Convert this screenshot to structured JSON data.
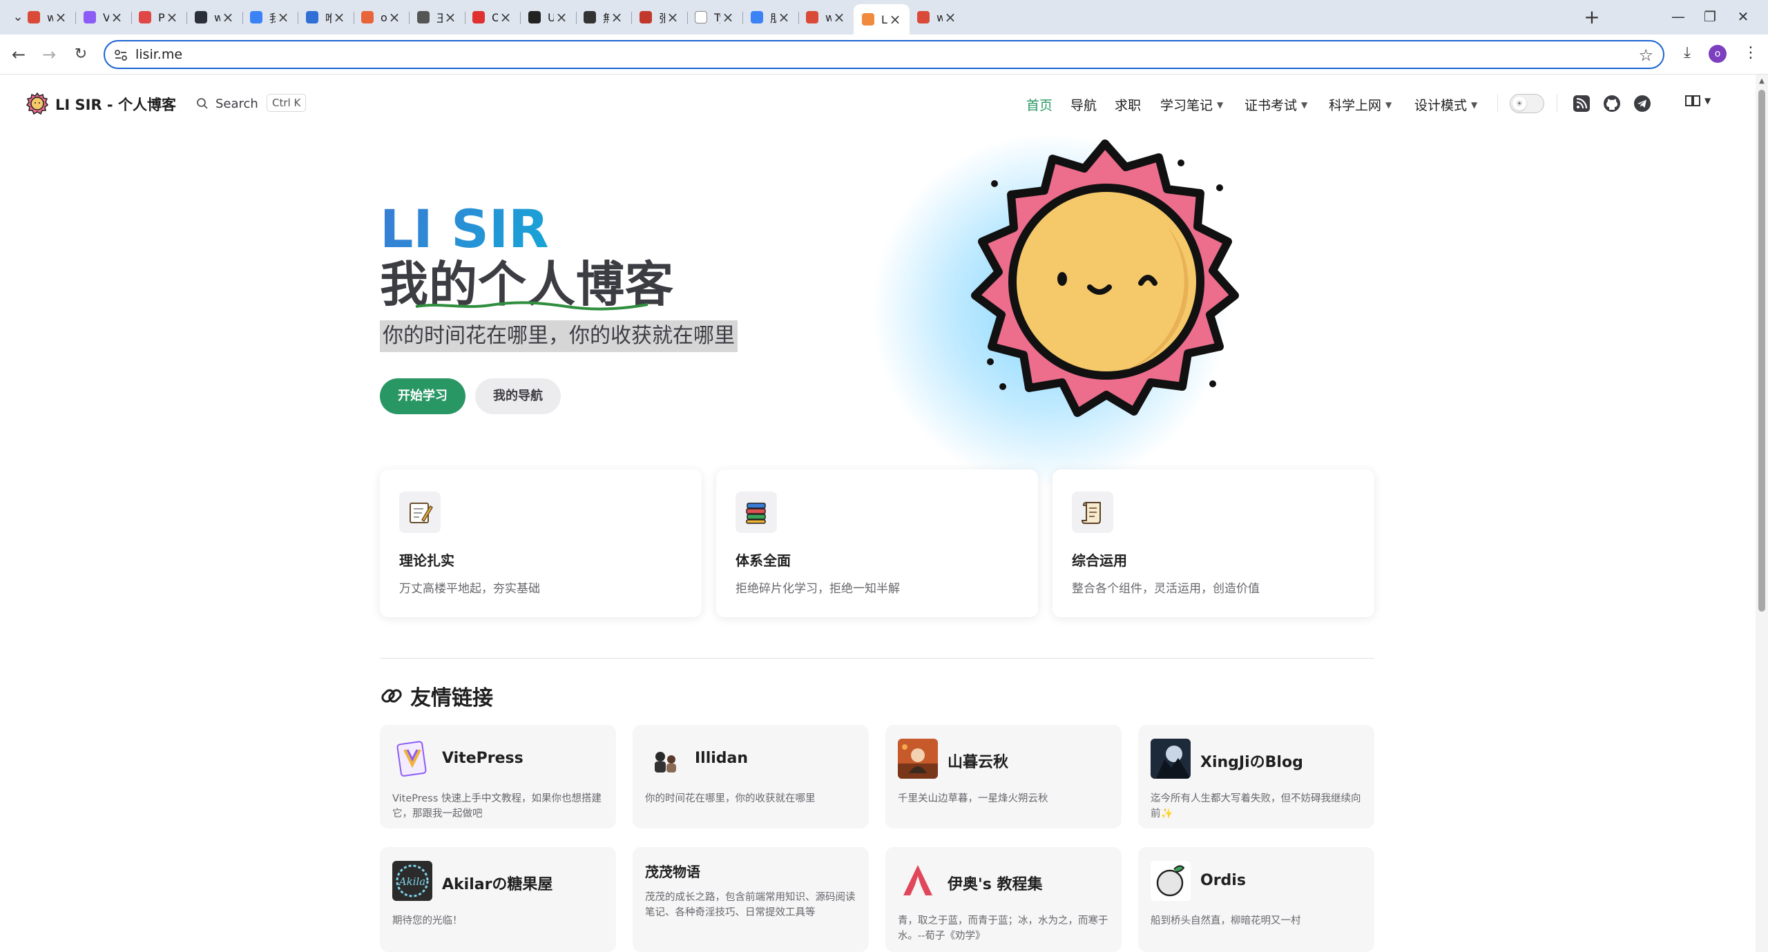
{
  "browser": {
    "tabs": [
      {
        "title": "w(°Д°",
        "favicon_color": "#d94a38"
      },
      {
        "title": "Vitep",
        "favicon_color": "#8b5cf6"
      },
      {
        "title": "POETI",
        "favicon_color": "#e04848"
      },
      {
        "title": "w(°Д°",
        "favicon_color": "#2b2f3a"
      },
      {
        "title": "我的",
        "favicon_color": "#3b82f6"
      },
      {
        "title": "唯知笔",
        "favicon_color": "#2f6fd6"
      },
      {
        "title": "oned",
        "favicon_color": "#e8653a"
      },
      {
        "title": "王嘉",
        "favicon_color": "#555555"
      },
      {
        "title": "One's",
        "favicon_color": "#e03131"
      },
      {
        "title": "Uman",
        "favicon_color": "#222222"
      },
      {
        "title": "無名",
        "favicon_color": "#333333"
      },
      {
        "title": "张洪",
        "favicon_color": "#c0392b"
      },
      {
        "title": "Typor",
        "favicon_color": "#ffffff"
      },
      {
        "title": "朋",
        "favicon_color": "#3b82f6"
      },
      {
        "title": "w(°Д°",
        "favicon_color": "#d94a38"
      },
      {
        "title": "LI SIR",
        "favicon_color": "#f08a3c",
        "active": true
      },
      {
        "title": "w(°Д°",
        "favicon_color": "#d94a38"
      }
    ],
    "url": "lisir.me",
    "profile_initial": "o"
  },
  "site": {
    "title": "LI SIR - 个人博客",
    "search_label": "Search",
    "search_shortcut": "Ctrl K",
    "nav": {
      "home": "首页",
      "guide": "导航",
      "jobs": "求职",
      "notes": "学习笔记",
      "exams": "证书考试",
      "science": "科学上网",
      "patterns": "设计模式"
    },
    "accent_color": "#299764"
  },
  "hero": {
    "name": "LI SIR",
    "text": "我的个人博客",
    "tagline": "你的时间花在哪里，你的收获就在哪里",
    "primary_action": "开始学习",
    "alt_action": "我的导航"
  },
  "features": [
    {
      "icon": "memo-icon",
      "title": "理论扎实",
      "details": "万丈高楼平地起，夯实基础"
    },
    {
      "icon": "books-icon",
      "title": "体系全面",
      "details": "拒绝碎片化学习，拒绝一知半解"
    },
    {
      "icon": "scroll-icon",
      "title": "综合运用",
      "details": "整合各个组件，灵活运用，创造价值"
    }
  ],
  "friends": {
    "title": "友情链接",
    "links": [
      {
        "name": "VitePress",
        "desc": "VitePress 快速上手中文教程，如果你也想搭建它，那跟我一起做吧",
        "avatar": "vitepress-logo"
      },
      {
        "name": "Illidan",
        "desc": "你的时间花在哪里，你的收获就在哪里",
        "avatar": "illidan-avatar"
      },
      {
        "name": "山暮云秋",
        "desc": "千里关山边草暮，一星烽火朔云秋",
        "avatar": "shanmu-avatar"
      },
      {
        "name": "XingJiのBlog",
        "desc": "迄今所有人生都大写着失败，但不妨碍我继续向前✨",
        "avatar": "xingji-avatar"
      },
      {
        "name": "Akilarの糖果屋",
        "desc": "期待您的光临！",
        "avatar": "akilar-avatar"
      },
      {
        "name": "茂茂物语",
        "desc": "茂茂的成长之路，包含前端常用知识、源码阅读笔记、各种奇淫技巧、日常提效工具等",
        "avatar": ""
      },
      {
        "name": "伊奥's 教程集",
        "desc": "青，取之于蓝，而青于蓝；冰，水为之，而寒于水。--荀子《劝学》",
        "avatar": "yiao-avatar"
      },
      {
        "name": "Ordis",
        "desc": "船到桥头自然直，柳暗花明又一村",
        "avatar": "ordis-avatar"
      }
    ]
  }
}
